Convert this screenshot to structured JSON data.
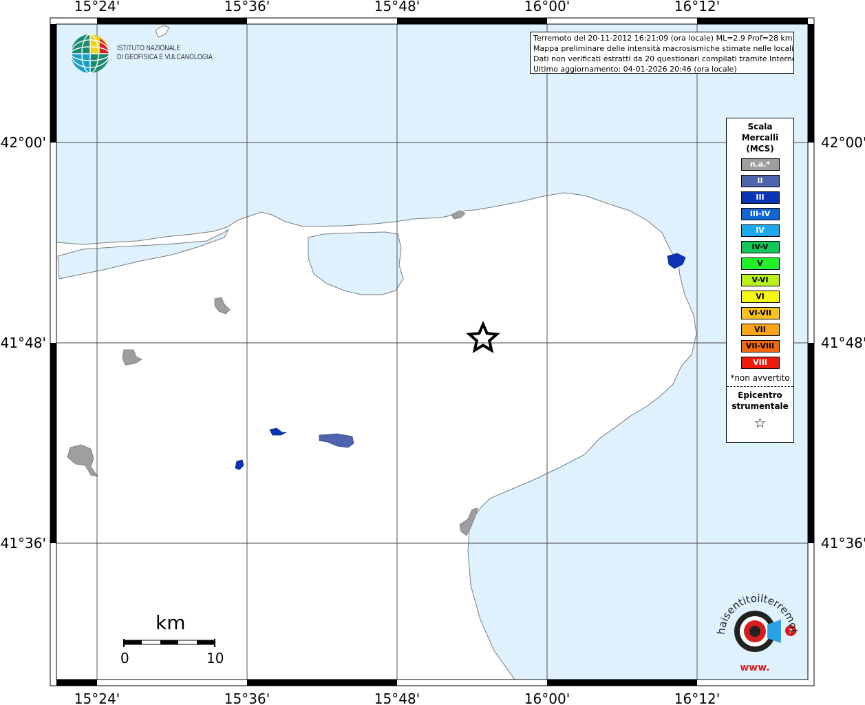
{
  "map": {
    "lon_labels": [
      "15°24'",
      "15°36'",
      "15°48'",
      "16°00'",
      "16°12'"
    ],
    "lat_labels": [
      "42°00'",
      "41°48'",
      "41°36'"
    ],
    "colors": {
      "sea": "#dff1fc",
      "land": "#ffffff",
      "coast": "#7a7a7a",
      "frame": "#000000"
    }
  },
  "logo": {
    "line1": "ISTITUTO NAZIONALE",
    "line2": "DI GEOFISICA E VULCANOLOGIA"
  },
  "info": {
    "line1": "Terremoto del 20-11-2012 16:21:09 (ora locale) ML=2.9 Prof=28 km",
    "line2": "Mappa preliminare delle intensità macrosismiche stimate nelle località",
    "line3": "Dati non verificati estratti da 20 questionari compilati tramite Internet.",
    "line4": "Ultimo aggiornamento: 04-01-2026 20:46 (ora locale)"
  },
  "legend": {
    "title1": "Scala",
    "title2": "Mercalli",
    "title3": "(MCS)",
    "items": [
      {
        "label": "n.a.*",
        "color": "#9e9e9e",
        "text": "#ffffff"
      },
      {
        "label": "II",
        "color": "#4e64ad",
        "text": "#ffffff"
      },
      {
        "label": "III",
        "color": "#0a33b5",
        "text": "#ffffff"
      },
      {
        "label": "III-IV",
        "color": "#1066d4",
        "text": "#ffffff"
      },
      {
        "label": "IV",
        "color": "#1ca8f0",
        "text": "#ffffff"
      },
      {
        "label": "IV-V",
        "color": "#12c85a",
        "text": "#000000"
      },
      {
        "label": "V",
        "color": "#22f02a",
        "text": "#000000"
      },
      {
        "label": "V-VI",
        "color": "#b8f01e",
        "text": "#000000"
      },
      {
        "label": "VI",
        "color": "#f6f614",
        "text": "#000000"
      },
      {
        "label": "VI-VII",
        "color": "#f7c21c",
        "text": "#000000"
      },
      {
        "label": "VII",
        "color": "#f7a516",
        "text": "#000000"
      },
      {
        "label": "VII-VIII",
        "color": "#f2680e",
        "text": "#000000"
      },
      {
        "label": "VIII",
        "color": "#ee1a0e",
        "text": "#ffffff"
      }
    ],
    "note": "*non avvertito",
    "epi1": "Epicentro",
    "epi2": "strumentale",
    "star": "☆"
  },
  "scalebar": {
    "unit": "km",
    "min": "0",
    "max": "10"
  },
  "hsit": {
    "text": "haisentitoilterremoto.it",
    "prefix": "www."
  }
}
